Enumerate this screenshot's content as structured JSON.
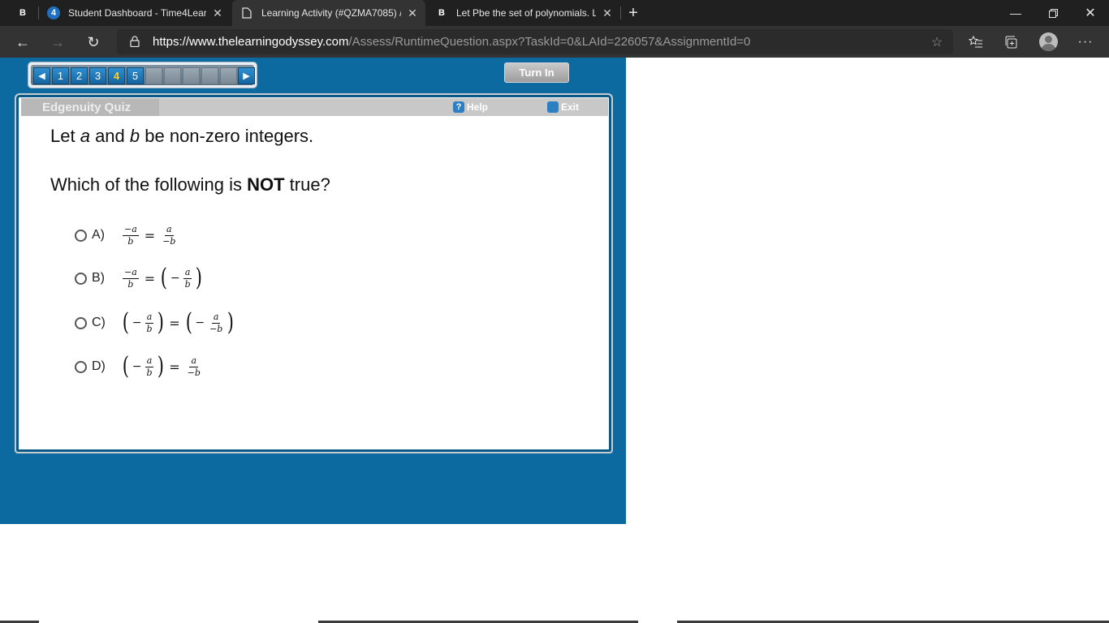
{
  "browser": {
    "tabs": [
      {
        "favicon": "B",
        "title": "",
        "active": false
      },
      {
        "favicon": "4",
        "title": "Student Dashboard - Time4Learr",
        "active": false
      },
      {
        "favicon": "page",
        "title": "Learning Activity (#QZMA7085) /",
        "active": true
      },
      {
        "favicon": "B",
        "title": "Let Pbe the set of polynomials. L",
        "active": false
      }
    ],
    "new_tab_label": "+",
    "url_host": "https://www.thelearningodyssey.com",
    "url_path": "/Assess/RuntimeQuestion.aspx?TaskId=0&LAId=226057&AssignmentId=0",
    "more_label": "···"
  },
  "quiz": {
    "question_numbers": [
      "1",
      "2",
      "3",
      "4",
      "5"
    ],
    "current_question": "4",
    "turn_in_label": "Turn In",
    "title": "Edgenuity Quiz",
    "help_label": "Help",
    "help_icon_glyph": "?",
    "exit_label": "Exit",
    "prompt_line1": {
      "pre": "Let ",
      "a": "a",
      "mid": " and ",
      "b": "b",
      "post": " be non-zero integers."
    },
    "prompt_line2": {
      "pre": "Which of the following is ",
      "bold": "NOT",
      "post": " true?"
    },
    "choices": [
      {
        "letter": "A)",
        "expression": "-a/b = a/(-b)"
      },
      {
        "letter": "B)",
        "expression": "-a/b = (-a/b)"
      },
      {
        "letter": "C)",
        "expression": "(-a/b) = (-a/(-b))"
      },
      {
        "letter": "D)",
        "expression": "(-a/b) = a/(-b)"
      }
    ],
    "math_tokens": {
      "minus_a": "−a",
      "a": "a",
      "b": "b",
      "minus_b": "−b",
      "minus": "−",
      "eq": "=",
      "lparen": "(",
      "rparen": ")"
    }
  },
  "colors": {
    "stage_blue": "#0d6aa0",
    "chrome_dark": "#202020",
    "address_bar": "#333333",
    "current_question": "#ffd21e"
  }
}
